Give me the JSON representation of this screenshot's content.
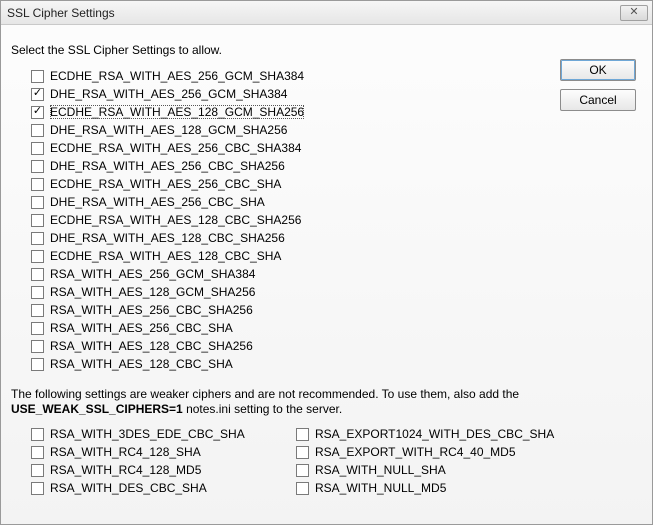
{
  "window": {
    "title": "SSL Cipher Settings"
  },
  "buttons": {
    "ok": "OK",
    "cancel": "Cancel"
  },
  "prompt": "Select the SSL Cipher Settings to allow.",
  "ciphers": [
    {
      "label": "ECDHE_RSA_WITH_AES_256_GCM_SHA384",
      "checked": false,
      "focused": false
    },
    {
      "label": "DHE_RSA_WITH_AES_256_GCM_SHA384",
      "checked": true,
      "focused": false
    },
    {
      "label": "ECDHE_RSA_WITH_AES_128_GCM_SHA256",
      "checked": true,
      "focused": true
    },
    {
      "label": "DHE_RSA_WITH_AES_128_GCM_SHA256",
      "checked": false,
      "focused": false
    },
    {
      "label": "ECDHE_RSA_WITH_AES_256_CBC_SHA384",
      "checked": false,
      "focused": false
    },
    {
      "label": "DHE_RSA_WITH_AES_256_CBC_SHA256",
      "checked": false,
      "focused": false
    },
    {
      "label": "ECDHE_RSA_WITH_AES_256_CBC_SHA",
      "checked": false,
      "focused": false
    },
    {
      "label": "DHE_RSA_WITH_AES_256_CBC_SHA",
      "checked": false,
      "focused": false
    },
    {
      "label": "ECDHE_RSA_WITH_AES_128_CBC_SHA256",
      "checked": false,
      "focused": false
    },
    {
      "label": "DHE_RSA_WITH_AES_128_CBC_SHA256",
      "checked": false,
      "focused": false
    },
    {
      "label": "ECDHE_RSA_WITH_AES_128_CBC_SHA",
      "checked": false,
      "focused": false
    },
    {
      "label": "RSA_WITH_AES_256_GCM_SHA384",
      "checked": false,
      "focused": false
    },
    {
      "label": "RSA_WITH_AES_128_GCM_SHA256",
      "checked": false,
      "focused": false
    },
    {
      "label": "RSA_WITH_AES_256_CBC_SHA256",
      "checked": false,
      "focused": false
    },
    {
      "label": "RSA_WITH_AES_256_CBC_SHA",
      "checked": false,
      "focused": false
    },
    {
      "label": "RSA_WITH_AES_128_CBC_SHA256",
      "checked": false,
      "focused": false
    },
    {
      "label": "RSA_WITH_AES_128_CBC_SHA",
      "checked": false,
      "focused": false
    }
  ],
  "weak_note": {
    "line1": "The following settings are weaker ciphers and are not recommended. To use them, also add the",
    "bold": "USE_WEAK_SSL_CIPHERS=1",
    "line2": " notes.ini setting to the server."
  },
  "weak_ciphers_left": [
    {
      "label": "RSA_WITH_3DES_EDE_CBC_SHA",
      "checked": false
    },
    {
      "label": "RSA_WITH_RC4_128_SHA",
      "checked": false
    },
    {
      "label": "RSA_WITH_RC4_128_MD5",
      "checked": false
    },
    {
      "label": "RSA_WITH_DES_CBC_SHA",
      "checked": false
    }
  ],
  "weak_ciphers_right": [
    {
      "label": "RSA_EXPORT1024_WITH_DES_CBC_SHA",
      "checked": false
    },
    {
      "label": "RSA_EXPORT_WITH_RC4_40_MD5",
      "checked": false
    },
    {
      "label": "RSA_WITH_NULL_SHA",
      "checked": false
    },
    {
      "label": "RSA_WITH_NULL_MD5",
      "checked": false
    }
  ]
}
